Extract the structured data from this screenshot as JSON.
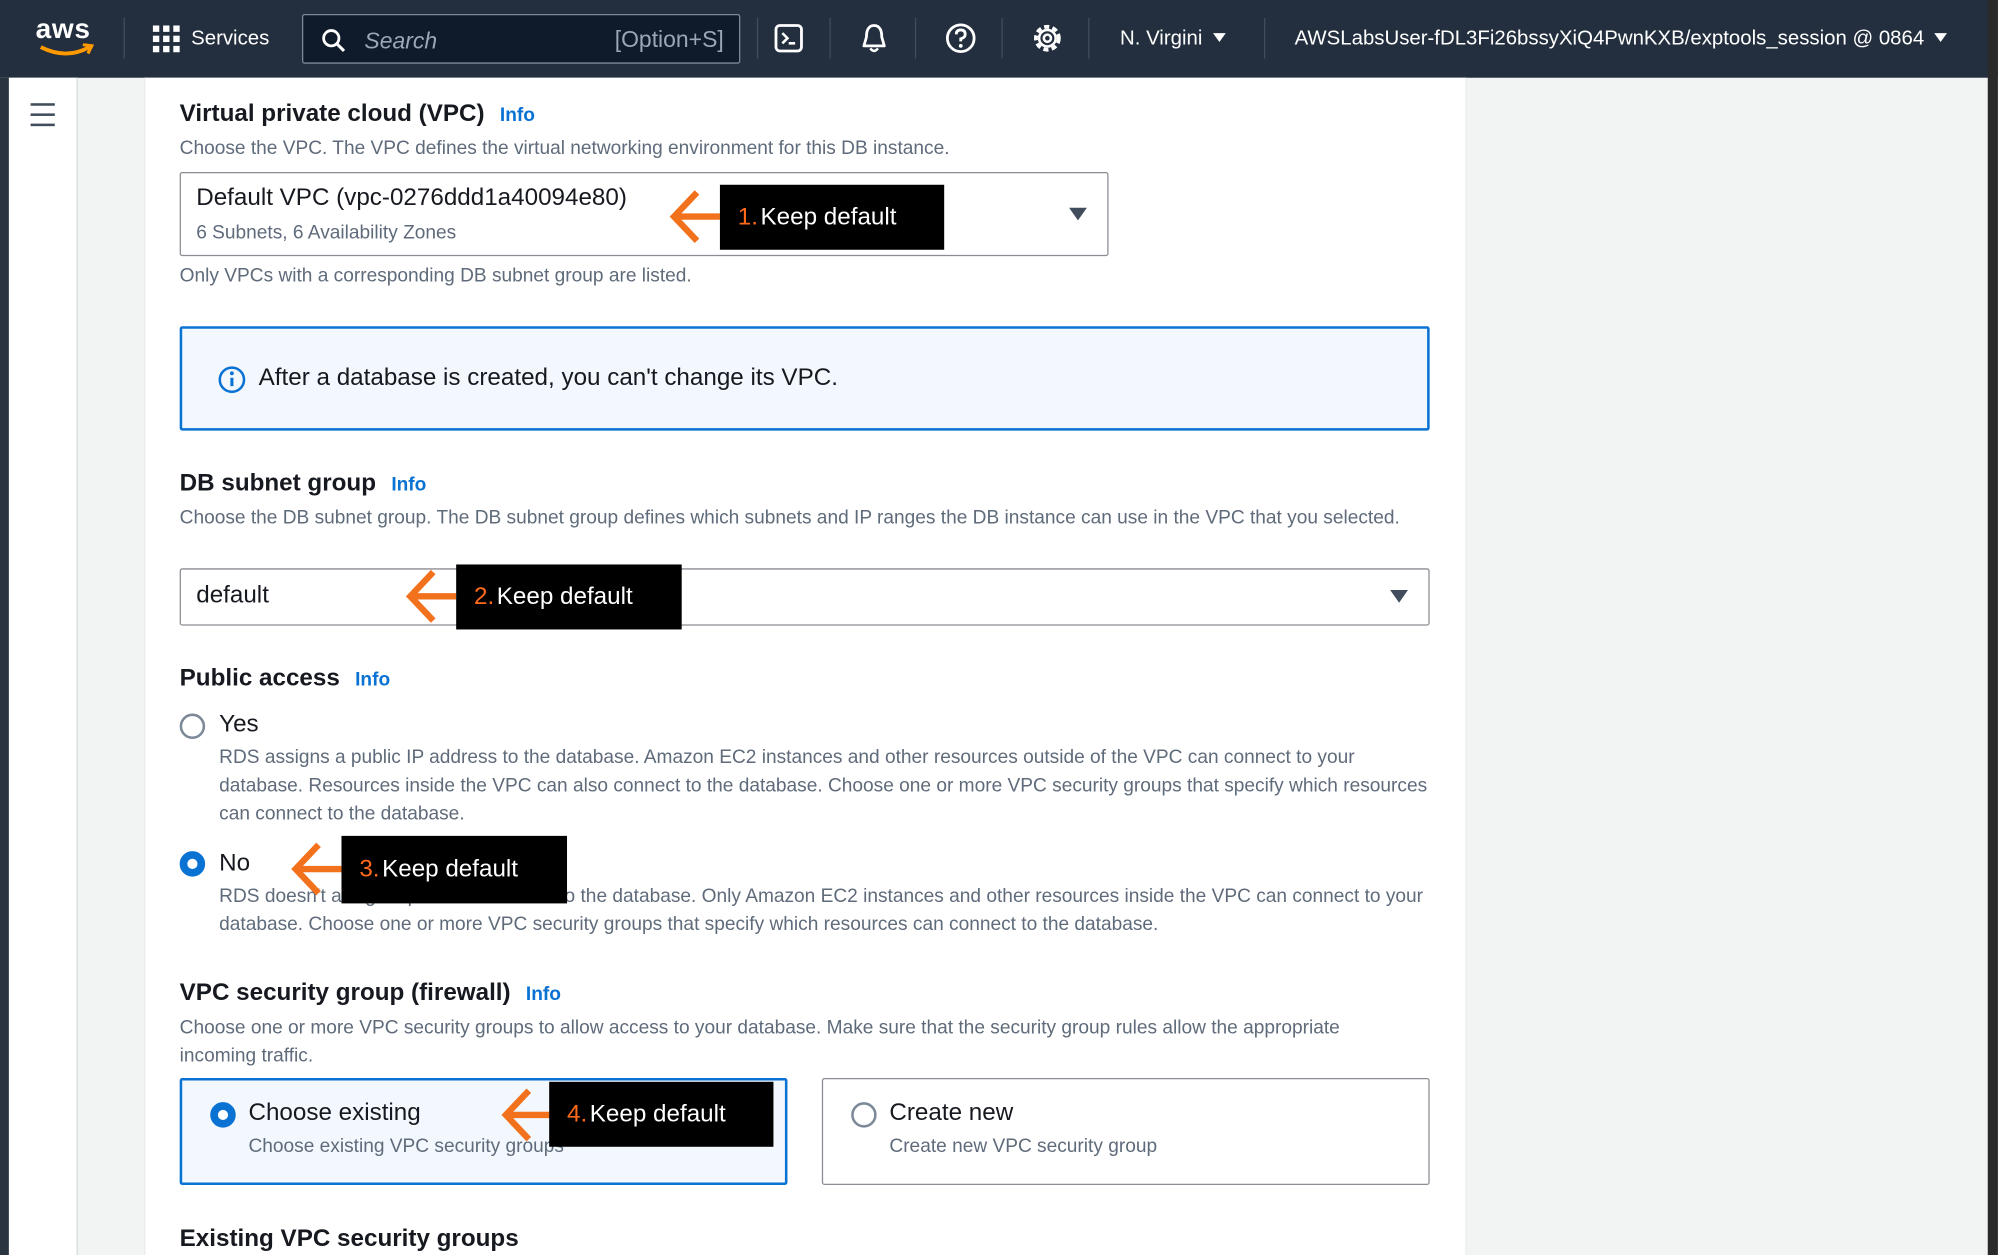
{
  "topnav": {
    "logo_text": "aws",
    "services_label": "Services",
    "search_placeholder": "Search",
    "search_shortcut": "[Option+S]",
    "region": "N. Virgini",
    "account": "AWSLabsUser-fDL3Fi26bssyXiQ4PwnKXB/exptools_session @ 0864",
    "icons": [
      "cloudshell-icon",
      "bell-icon",
      "help-icon",
      "gear-icon"
    ]
  },
  "vpc": {
    "label": "Virtual private cloud (VPC)",
    "info": "Info",
    "description": "Choose the VPC. The VPC defines the virtual networking environment for this DB instance.",
    "selected": "Default VPC (vpc-0276ddd1a40094e80)",
    "selected_sub": "6 Subnets, 6 Availability Zones",
    "hint": "Only VPCs with a corresponding DB subnet group are listed."
  },
  "alert": {
    "text": "After a database is created, you can't change its VPC."
  },
  "subnet": {
    "label": "DB subnet group",
    "info": "Info",
    "description": "Choose the DB subnet group. The DB subnet group defines which subnets and IP ranges the DB instance can use in the VPC that you selected.",
    "selected": "default"
  },
  "public_access": {
    "label": "Public access",
    "info": "Info",
    "yes_label": "Yes",
    "yes_desc": "RDS assigns a public IP address to the database. Amazon EC2 instances and other resources outside of the VPC can connect to your database. Resources inside the VPC can also connect to the database. Choose one or more VPC security groups that specify which resources can connect to the database.",
    "no_label": "No",
    "no_desc": "RDS doesn't assign a public IP address to the database. Only Amazon EC2 instances and other resources inside the VPC can connect to your database. Choose one or more VPC security groups that specify which resources can connect to the database.",
    "selected": "No"
  },
  "security_group": {
    "label": "VPC security group (firewall)",
    "info": "Info",
    "description": "Choose one or more VPC security groups to allow access to your database. Make sure that the security group rules allow the appropriate incoming traffic.",
    "existing_label": "Choose existing",
    "existing_desc": "Choose existing VPC security groups",
    "new_label": "Create new",
    "new_desc": "Create new VPC security group",
    "selected": "Choose existing"
  },
  "existing_groups_label": "Existing VPC security groups",
  "callouts": [
    {
      "num": "1.",
      "text": "Keep default"
    },
    {
      "num": "2.",
      "text": "Keep default"
    },
    {
      "num": "3.",
      "text": "Keep default"
    },
    {
      "num": "4.",
      "text": "Keep default"
    }
  ],
  "colors": {
    "nav_bg": "#232f3e",
    "accent": "#0972d3",
    "callout_bg": "#000000",
    "callout_num": "#ff6a1a",
    "arrow": "#f2711c"
  }
}
